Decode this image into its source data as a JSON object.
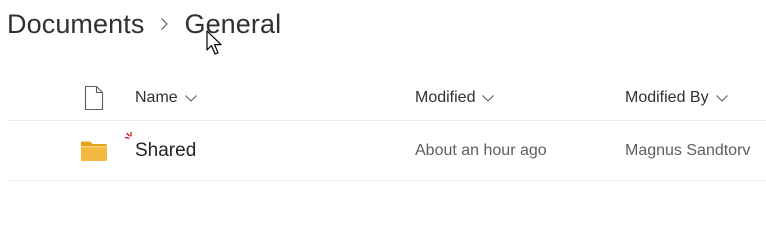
{
  "breadcrumb": {
    "items": [
      {
        "label": "Documents"
      },
      {
        "label": "General"
      }
    ]
  },
  "table": {
    "columns": {
      "type_icon": "file-type-icon",
      "name": "Name",
      "modified": "Modified",
      "modified_by": "Modified By"
    },
    "rows": [
      {
        "type": "folder",
        "name": "Shared",
        "modified": "About an hour ago",
        "modified_by": "Magnus Sandtorv",
        "is_new": true
      }
    ]
  },
  "colors": {
    "text_primary": "#323130",
    "text_secondary": "#605e5c",
    "divider": "#edebe9",
    "folder_yellow": "#f4b942",
    "folder_dark": "#e6a319",
    "new_marker": "#c50f1f"
  }
}
